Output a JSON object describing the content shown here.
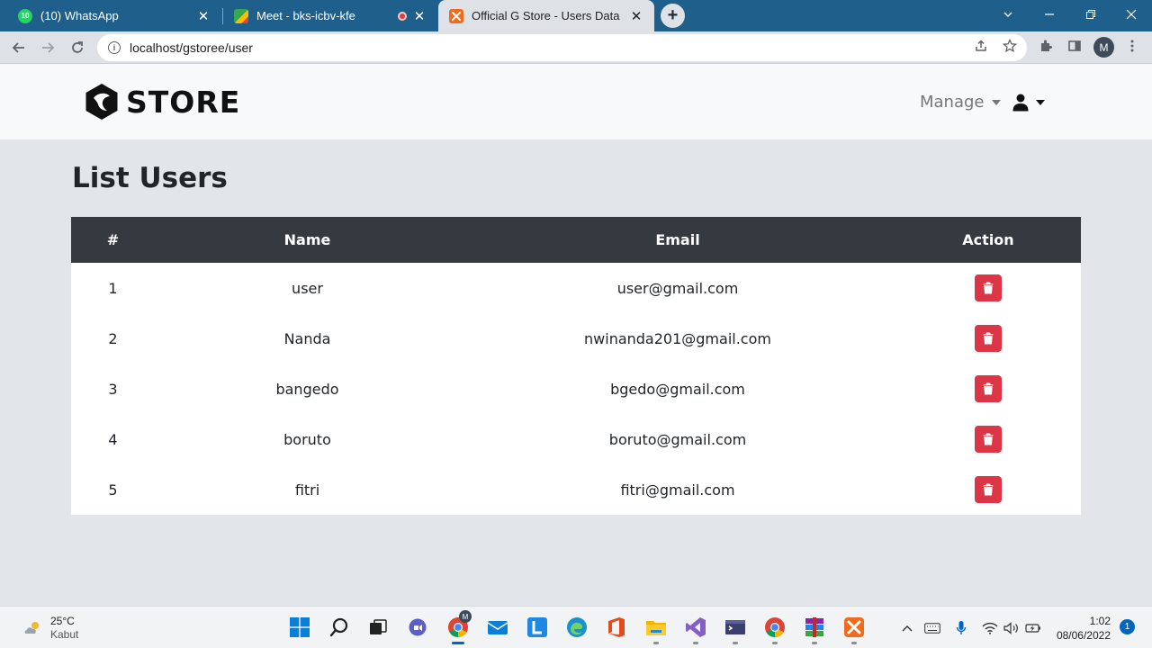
{
  "browser": {
    "tabs": [
      {
        "title": "(10) WhatsApp",
        "badge": "10",
        "active": false
      },
      {
        "title": "Meet - bks-icbv-kfe",
        "active": false
      },
      {
        "title": "Official G Store - Users Data",
        "active": true
      }
    ],
    "url": "localhost/gstoree/user",
    "profile_initial": "M",
    "new_tab": "+",
    "close_glyph": "✕"
  },
  "navbar": {
    "brand": "STORE",
    "manage_label": "Manage"
  },
  "page": {
    "title": "List Users",
    "table": {
      "headers": [
        "#",
        "Name",
        "Email",
        "Action"
      ],
      "rows": [
        {
          "num": "1",
          "name": "user",
          "email": "user@gmail.com"
        },
        {
          "num": "2",
          "name": "Nanda",
          "email": "nwinanda201@gmail.com"
        },
        {
          "num": "3",
          "name": "bangedo",
          "email": "bgedo@gmail.com"
        },
        {
          "num": "4",
          "name": "boruto",
          "email": "boruto@gmail.com"
        },
        {
          "num": "5",
          "name": "fitri",
          "email": "fitri@gmail.com"
        }
      ]
    },
    "delete_color": "#dc3545",
    "header_bg": "#343a40"
  },
  "taskbar": {
    "temperature": "25°C",
    "condition": "Kabut",
    "time": "1:02",
    "date": "08/06/2022",
    "notifications": "1",
    "chrome_badge": "M"
  }
}
